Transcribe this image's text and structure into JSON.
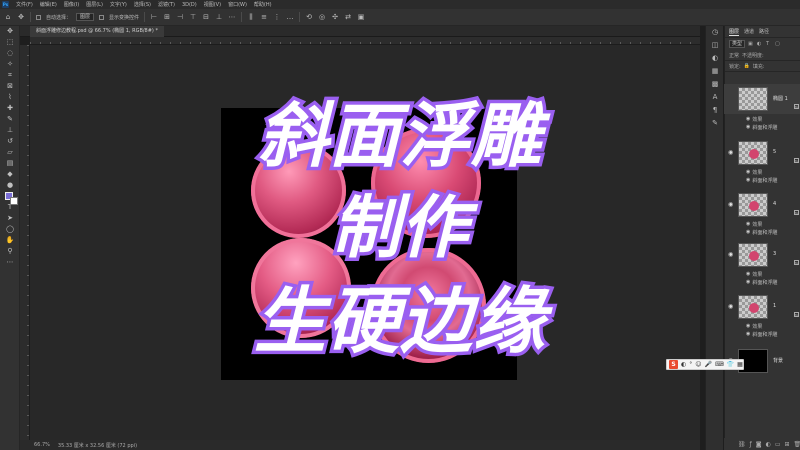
{
  "menubar": {
    "items": [
      "文件(F)",
      "编辑(E)",
      "图像(I)",
      "图层(L)",
      "文字(Y)",
      "选择(S)",
      "滤镜(T)",
      "3D(D)",
      "视图(V)",
      "窗口(W)",
      "帮助(H)"
    ]
  },
  "options": {
    "auto_select_label": "自动选择：",
    "auto_select_value": "图层",
    "transform_label": "显示变换控件"
  },
  "document": {
    "tab_label": "斜面浮雕修边教程.psd @ 66.7% (椭圆 1, RGB/8#) *"
  },
  "title": {
    "line1": "斜面浮雕",
    "line2": "制作",
    "line3": "生硬边缘"
  },
  "status": {
    "zoom": "66.7%",
    "doc_size": "35.33 厘米 x 32.56 厘米 (72 ppi)"
  },
  "layers_panel": {
    "tabs": [
      "图层",
      "通道",
      "路径"
    ],
    "filter_value": "类型",
    "blend_mode": "正常",
    "opacity_label": "不透明度:",
    "lock_label": "锁定:",
    "fill_label": "填充:",
    "effects_label": "效果",
    "bevel_label": "斜面和浮雕",
    "layers": [
      {
        "name": "椭圆 1",
        "selected": true
      },
      {
        "name": "5"
      },
      {
        "name": "4"
      },
      {
        "name": "3"
      },
      {
        "name": "1"
      },
      {
        "name": "背景"
      }
    ]
  },
  "colors": {
    "accent_purple": "#9a5ff0",
    "ball_pink": "#d2456e",
    "ps_dark": "#323232"
  },
  "icons": {
    "ime_logo": "S"
  }
}
